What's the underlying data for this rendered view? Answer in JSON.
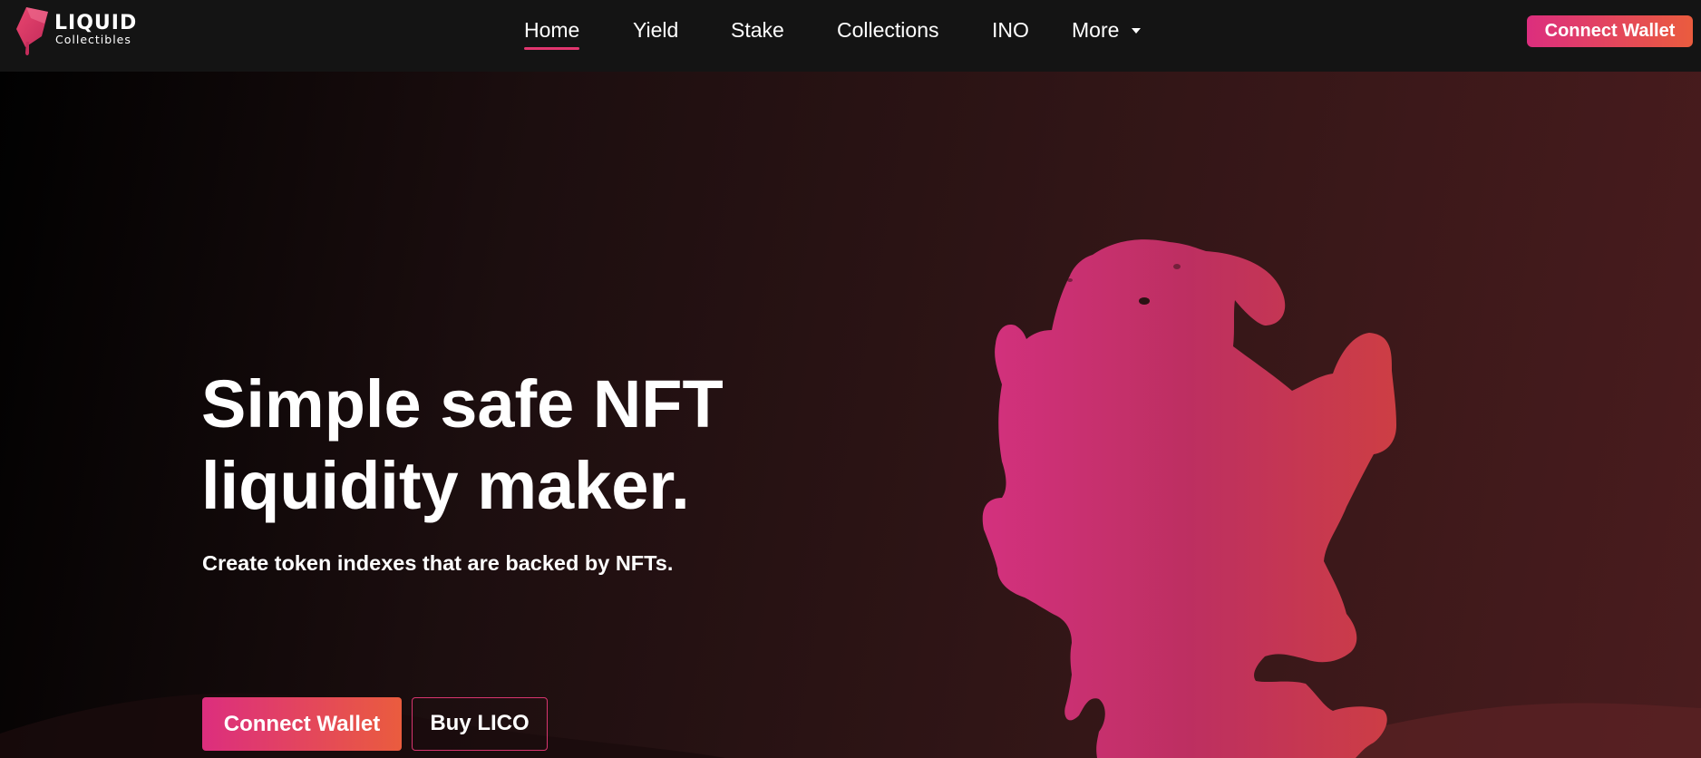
{
  "brand": {
    "name": "LIQUID",
    "subtitle": "Collectibles",
    "logo_icon": "liquid-drop-logo-icon"
  },
  "nav": {
    "items": [
      {
        "label": "Home",
        "active": true
      },
      {
        "label": "Yield"
      },
      {
        "label": "Stake"
      },
      {
        "label": "Collections"
      },
      {
        "label": "INO"
      },
      {
        "label": "More",
        "icon": "caret-down-icon"
      }
    ],
    "connect_label": "Connect Wallet"
  },
  "hero": {
    "title_line1": "Simple safe NFT",
    "title_line2": "liquidity maker.",
    "subtitle": "Create token indexes that are backed by NFTs.",
    "primary_label": "Connect Wallet",
    "secondary_label": "Buy LICO",
    "illustration": "melting-liquid-blob"
  },
  "colors": {
    "accent_start": "#dc2e7e",
    "accent_end": "#ea5c3e",
    "nav_bg": "#141414",
    "underline": "#e2366f",
    "hero_bg_dark": "#010101",
    "hero_bg_warm": "#4a1c1e"
  }
}
